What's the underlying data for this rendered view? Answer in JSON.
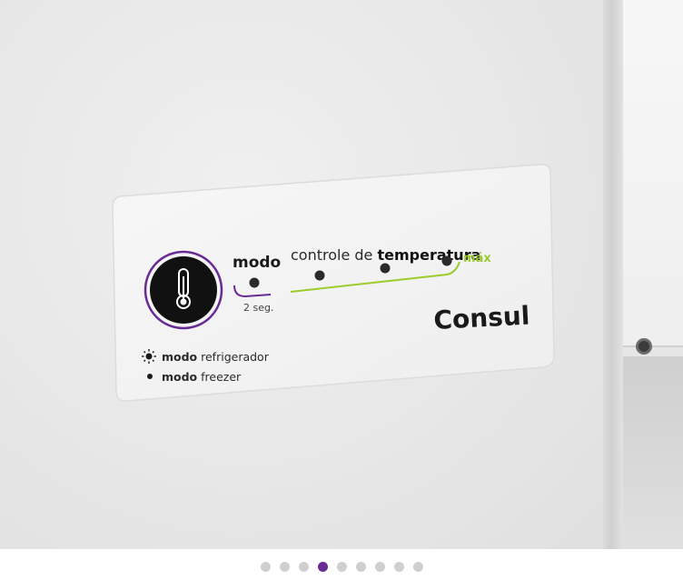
{
  "panel": {
    "mode_label": "modo",
    "hold_label": "2 seg.",
    "temp_label_light": "controle de ",
    "temp_label_bold": "temperatura",
    "max_label": "máx",
    "brand": "Consul",
    "legend": [
      {
        "bold": "modo",
        "text": " refrigerador",
        "icon": "sun-icon"
      },
      {
        "bold": "modo",
        "text": " freezer",
        "icon": "dot-icon"
      }
    ],
    "colors": {
      "accent_purple": "#6a2a96",
      "accent_green": "#9ccb2e"
    }
  },
  "carousel": {
    "count": 9,
    "active_index": 3
  }
}
